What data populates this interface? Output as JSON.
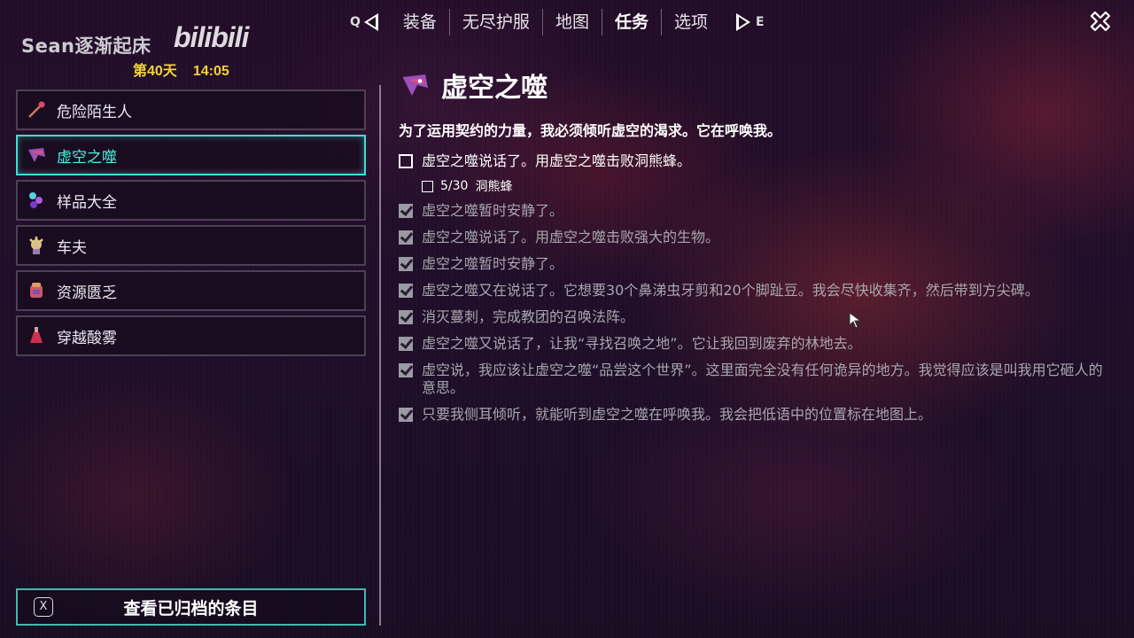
{
  "watermark": {
    "text": "Sean逐渐起床",
    "logo": "bilibili"
  },
  "day": {
    "label": "第40天",
    "time": "14:05"
  },
  "nav": {
    "prev_key": "Q",
    "next_key": "E",
    "tabs": [
      "装备",
      "无尽护服",
      "地图",
      "任务",
      "选项"
    ],
    "active_index": 3
  },
  "quests": [
    {
      "label": "危险陌生人",
      "icon": "wand-icon"
    },
    {
      "label": "虚空之噬",
      "icon": "void-maw-icon",
      "selected": true
    },
    {
      "label": "样品大全",
      "icon": "samples-icon"
    },
    {
      "label": "车夫",
      "icon": "coachman-icon"
    },
    {
      "label": "资源匮乏",
      "icon": "resources-icon"
    },
    {
      "label": "穿越酸雾",
      "icon": "acid-flask-icon"
    }
  ],
  "archive_button": {
    "key": "X",
    "label": "查看已归档的条目"
  },
  "detail": {
    "title": "虚空之噬",
    "description": "为了运用契约的力量，我必须倾听虚空的渴求。它在呼唤我。",
    "current_step": {
      "text": "虚空之噬说话了。用虚空之噬击败洞熊蜂。",
      "sub": {
        "count": "5/30",
        "text": "洞熊蜂"
      }
    },
    "completed_steps": [
      "虚空之噬暂时安静了。",
      "虚空之噬说话了。用虚空之噬击败强大的生物。",
      "虚空之噬暂时安静了。",
      "虚空之噬又在说话了。它想要30个鼻涕虫牙剪和20个脚趾豆。我会尽快收集齐，然后带到方尖碑。",
      "消灭蔓刺，完成教团的召唤法阵。",
      "虚空之噬又说话了，让我“寻找召唤之地”。它让我回到废弃的林地去。",
      "虚空说，我应该让虚空之噬“品尝这个世界”。这里面完全没有任何诡异的地方。我觉得应该是叫我用它砸人的意思。",
      "只要我侧耳倾听，就能听到虚空之噬在呼唤我。我会把低语中的位置标在地图上。"
    ]
  },
  "colors": {
    "accent": "#3ce0cf",
    "day_text": "#f3d33a"
  }
}
